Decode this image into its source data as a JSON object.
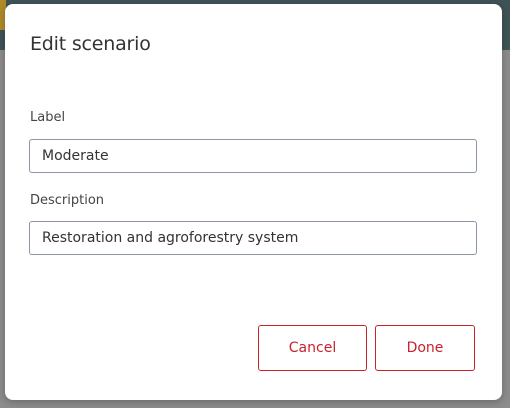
{
  "dialog": {
    "title": "Edit scenario",
    "label_field": {
      "label": "Label",
      "value": "Moderate"
    },
    "description_field": {
      "label": "Description",
      "value": "Restoration and agroforestry system"
    },
    "buttons": {
      "cancel": "Cancel",
      "done": "Done"
    },
    "accent_color": "#c8222b"
  }
}
